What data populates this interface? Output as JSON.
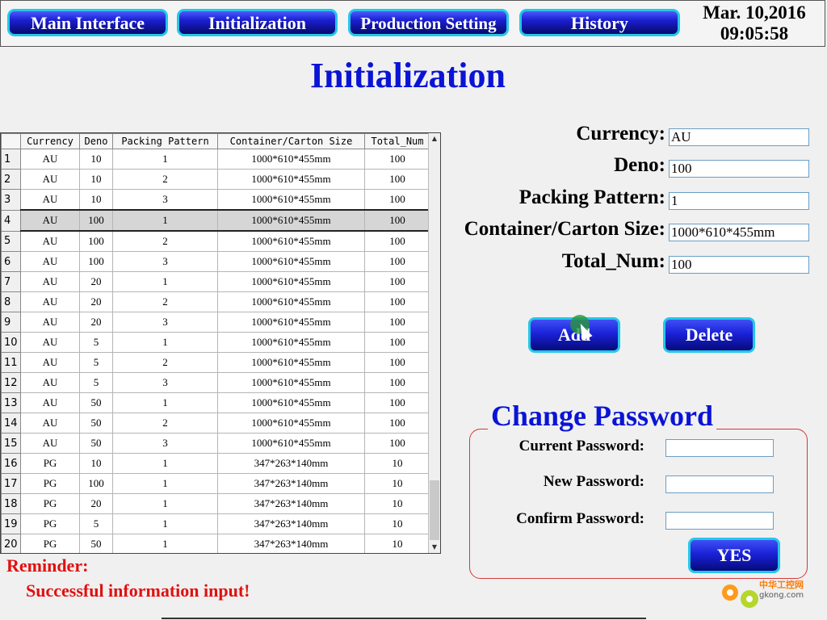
{
  "nav": {
    "main_interface": "Main Interface",
    "initialization": "Initialization",
    "production_setting": "Production Setting",
    "history": "History"
  },
  "datetime": {
    "date": "Mar. 10,2016",
    "time": "09:05:58"
  },
  "page_title": "Initialization",
  "table": {
    "headers": [
      "Currency",
      "Deno",
      "Packing Pattern",
      "Container/Carton Size",
      "Total_Num"
    ],
    "selected_row": 4,
    "rows": [
      {
        "n": "1",
        "currency": "AU",
        "deno": "10",
        "pattern": "1",
        "size": "1000*610*455mm",
        "total": "100"
      },
      {
        "n": "2",
        "currency": "AU",
        "deno": "10",
        "pattern": "2",
        "size": "1000*610*455mm",
        "total": "100"
      },
      {
        "n": "3",
        "currency": "AU",
        "deno": "10",
        "pattern": "3",
        "size": "1000*610*455mm",
        "total": "100"
      },
      {
        "n": "4",
        "currency": "AU",
        "deno": "100",
        "pattern": "1",
        "size": "1000*610*455mm",
        "total": "100"
      },
      {
        "n": "5",
        "currency": "AU",
        "deno": "100",
        "pattern": "2",
        "size": "1000*610*455mm",
        "total": "100"
      },
      {
        "n": "6",
        "currency": "AU",
        "deno": "100",
        "pattern": "3",
        "size": "1000*610*455mm",
        "total": "100"
      },
      {
        "n": "7",
        "currency": "AU",
        "deno": "20",
        "pattern": "1",
        "size": "1000*610*455mm",
        "total": "100"
      },
      {
        "n": "8",
        "currency": "AU",
        "deno": "20",
        "pattern": "2",
        "size": "1000*610*455mm",
        "total": "100"
      },
      {
        "n": "9",
        "currency": "AU",
        "deno": "20",
        "pattern": "3",
        "size": "1000*610*455mm",
        "total": "100"
      },
      {
        "n": "10",
        "currency": "AU",
        "deno": "5",
        "pattern": "1",
        "size": "1000*610*455mm",
        "total": "100"
      },
      {
        "n": "11",
        "currency": "AU",
        "deno": "5",
        "pattern": "2",
        "size": "1000*610*455mm",
        "total": "100"
      },
      {
        "n": "12",
        "currency": "AU",
        "deno": "5",
        "pattern": "3",
        "size": "1000*610*455mm",
        "total": "100"
      },
      {
        "n": "13",
        "currency": "AU",
        "deno": "50",
        "pattern": "1",
        "size": "1000*610*455mm",
        "total": "100"
      },
      {
        "n": "14",
        "currency": "AU",
        "deno": "50",
        "pattern": "2",
        "size": "1000*610*455mm",
        "total": "100"
      },
      {
        "n": "15",
        "currency": "AU",
        "deno": "50",
        "pattern": "3",
        "size": "1000*610*455mm",
        "total": "100"
      },
      {
        "n": "16",
        "currency": "PG",
        "deno": "10",
        "pattern": "1",
        "size": "347*263*140mm",
        "total": "10"
      },
      {
        "n": "17",
        "currency": "PG",
        "deno": "100",
        "pattern": "1",
        "size": "347*263*140mm",
        "total": "10"
      },
      {
        "n": "18",
        "currency": "PG",
        "deno": "20",
        "pattern": "1",
        "size": "347*263*140mm",
        "total": "10"
      },
      {
        "n": "19",
        "currency": "PG",
        "deno": "5",
        "pattern": "1",
        "size": "347*263*140mm",
        "total": "10"
      },
      {
        "n": "20",
        "currency": "PG",
        "deno": "50",
        "pattern": "1",
        "size": "347*263*140mm",
        "total": "10"
      }
    ]
  },
  "form": {
    "currency_label": "Currency:",
    "currency_value": "AU",
    "deno_label": "Deno:",
    "deno_value": "100",
    "pattern_label": "Packing Pattern:",
    "pattern_value": "1",
    "size_label": "Container/Carton Size:",
    "size_value": "1000*610*455mm",
    "total_label": "Total_Num:",
    "total_value": "100",
    "add_label": "Add",
    "delete_label": "Delete"
  },
  "password": {
    "title": "Change Password",
    "current_label": "Current Password:",
    "new_label": "New Password:",
    "confirm_label": "Confirm Password:",
    "yes_label": "YES"
  },
  "reminder": {
    "title": "Reminder:",
    "message": "Successful information input!"
  },
  "watermark": {
    "text": "中华工控网",
    "url": "gkong.com"
  },
  "colors": {
    "accent_blue": "#0a14d6",
    "button_border": "#22c8e8",
    "reminder_red": "#e01010"
  }
}
